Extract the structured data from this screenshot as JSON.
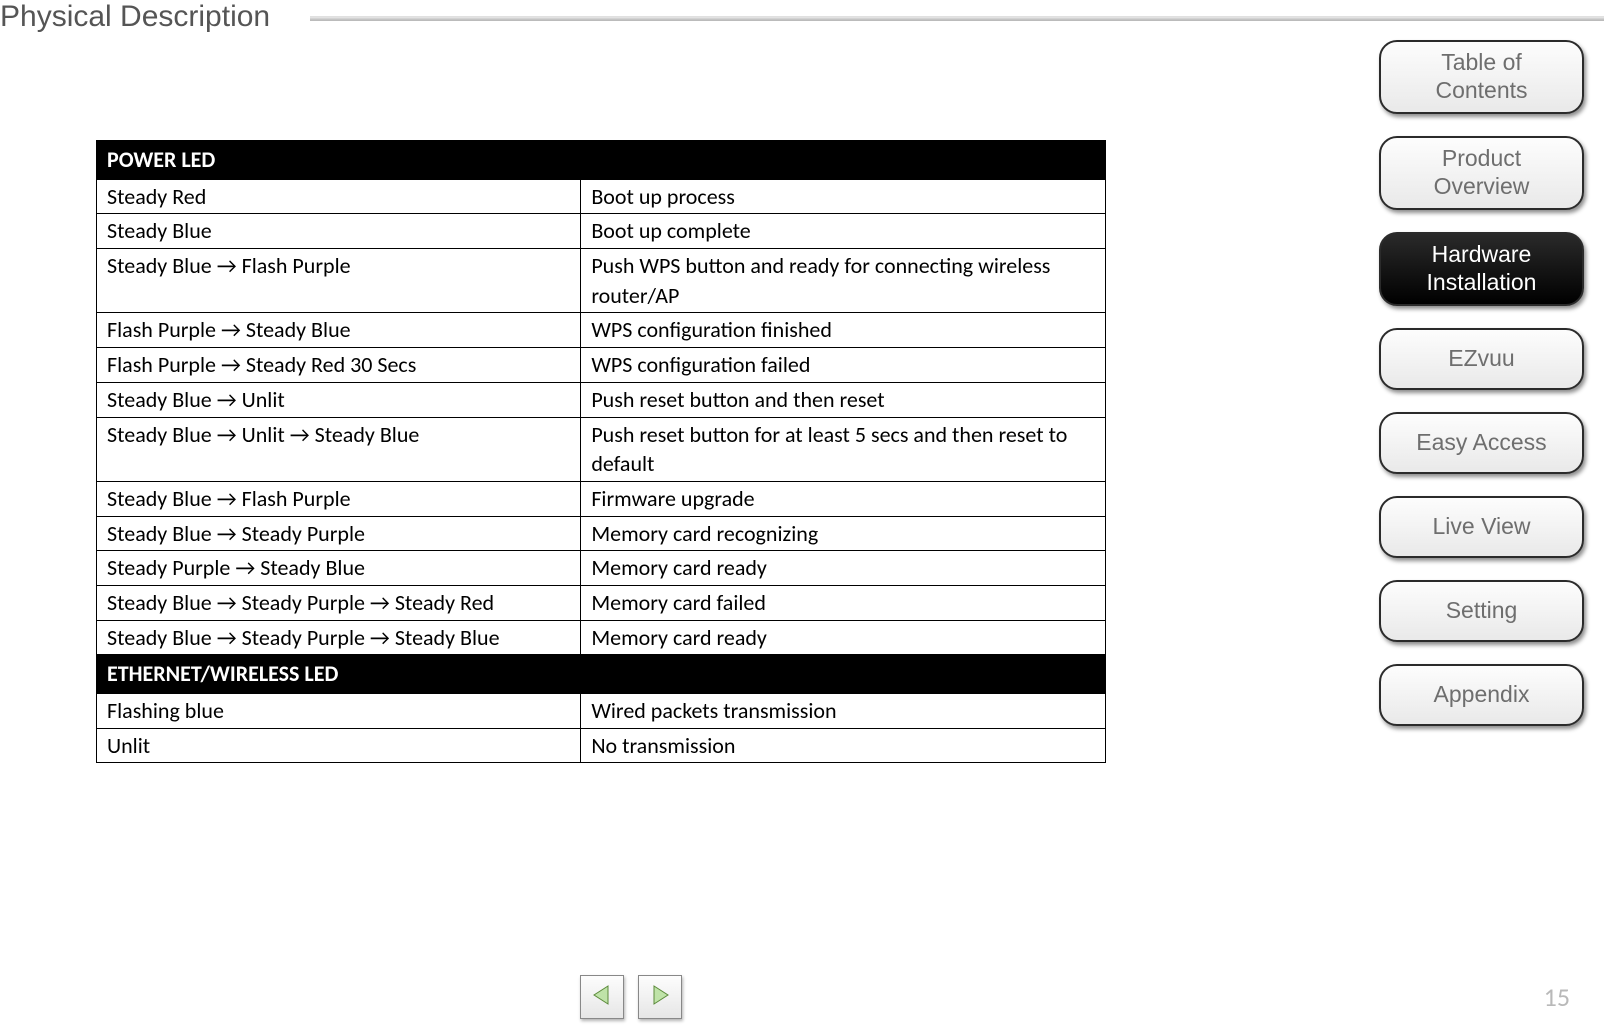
{
  "header": {
    "title": "Physical Description"
  },
  "tables": {
    "power_led_header": "POWER LED",
    "power_led_rows": [
      {
        "state": "Steady Red",
        "meaning": "Boot up process"
      },
      {
        "state": "Steady Blue",
        "meaning": "Boot up complete"
      },
      {
        "state": "Steady Blue → Flash Purple",
        "meaning": "Push WPS button and ready for connecting wireless router/AP"
      },
      {
        "state": "Flash Purple → Steady Blue",
        "meaning": "WPS configuration finished"
      },
      {
        "state": "Flash Purple → Steady Red 30 Secs",
        "meaning": "WPS configuration failed"
      },
      {
        "state": "Steady Blue → Unlit",
        "meaning": "Push reset button and then reset"
      },
      {
        "state": "Steady Blue → Unlit → Steady Blue",
        "meaning": "Push reset button for at least 5 secs and then reset to default"
      },
      {
        "state": "Steady Blue → Flash Purple",
        "meaning": "Firmware upgrade"
      },
      {
        "state": "Steady Blue → Steady Purple",
        "meaning": "Memory card recognizing"
      },
      {
        "state": "Steady Purple → Steady Blue",
        "meaning": "Memory card ready"
      },
      {
        "state": "Steady  Blue → Steady Purple → Steady Red",
        "meaning": "Memory card failed"
      },
      {
        "state": "Steady  Blue → Steady Purple → Steady Blue",
        "meaning": "Memory card ready"
      }
    ],
    "eth_led_header": "ETHERNET/WIRELESS  LED",
    "eth_led_rows": [
      {
        "state": "Flashing blue",
        "meaning": "Wired packets transmission"
      },
      {
        "state": "Unlit",
        "meaning": "No transmission"
      }
    ]
  },
  "sidebar": {
    "items": [
      {
        "label": "Table of\nContents",
        "active": false
      },
      {
        "label": "Product\nOverview",
        "active": false
      },
      {
        "label": "Hardware\nInstallation",
        "active": true
      },
      {
        "label": "EZvuu",
        "active": false
      },
      {
        "label": "Easy Access",
        "active": false
      },
      {
        "label": "Live View",
        "active": false
      },
      {
        "label": "Setting",
        "active": false
      },
      {
        "label": "Appendix",
        "active": false
      }
    ]
  },
  "page_number": "15"
}
